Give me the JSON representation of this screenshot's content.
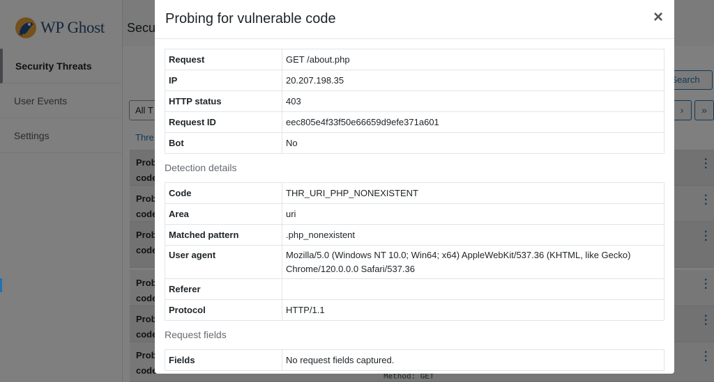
{
  "app": {
    "brand": "WP Ghost",
    "page_title": "Secu",
    "nav": [
      {
        "label": "Security Threats"
      },
      {
        "label": "User Events"
      },
      {
        "label": "Settings"
      }
    ],
    "search_button": "Search",
    "filter_value": "All T",
    "pager": {
      "next": "›",
      "last": "»"
    },
    "threats_link": "Thre",
    "rows": [
      {
        "line1": "Prob",
        "line2": "code"
      },
      {
        "line1": "Prob",
        "line2": "code"
      },
      {
        "line1": "Prob",
        "line2": "code"
      },
      {
        "line1": "Prob",
        "line2": "code"
      },
      {
        "line1": "Prob",
        "line2": "code"
      },
      {
        "line1": "Prob",
        "line2": "code"
      }
    ],
    "method_line": "Method: GET"
  },
  "modal": {
    "title": "Probing for vulnerable code",
    "close_glyph": "×",
    "request": {
      "rows": [
        {
          "key": "Request",
          "value": "GET /about.php"
        },
        {
          "key": "IP",
          "value": "20.207.198.35"
        },
        {
          "key": "HTTP status",
          "value": "403"
        },
        {
          "key": "Request ID",
          "value": "eec805e4f33f50e66659d9efe371a601"
        },
        {
          "key": "Bot",
          "value": "No"
        }
      ]
    },
    "detection": {
      "heading": "Detection details",
      "rows": [
        {
          "key": "Code",
          "value": "THR_URI_PHP_NONEXISTENT"
        },
        {
          "key": "Area",
          "value": "uri"
        },
        {
          "key": "Matched pattern",
          "value": ".php_nonexistent"
        },
        {
          "key": "User agent",
          "value": "Mozilla/5.0 (Windows NT 10.0; Win64; x64) AppleWebKit/537.36 (KHTML, like Gecko) Chrome/120.0.0.0 Safari/537.36"
        },
        {
          "key": "Referer",
          "value": ""
        },
        {
          "key": "Protocol",
          "value": "HTTP/1.1"
        }
      ]
    },
    "fields": {
      "heading": "Request fields",
      "rows": [
        {
          "key": "Fields",
          "value": "No request fields captured."
        }
      ]
    }
  },
  "colors": {
    "accent": "#2271b1",
    "overlay": "rgba(0,0,0,0.5)"
  }
}
